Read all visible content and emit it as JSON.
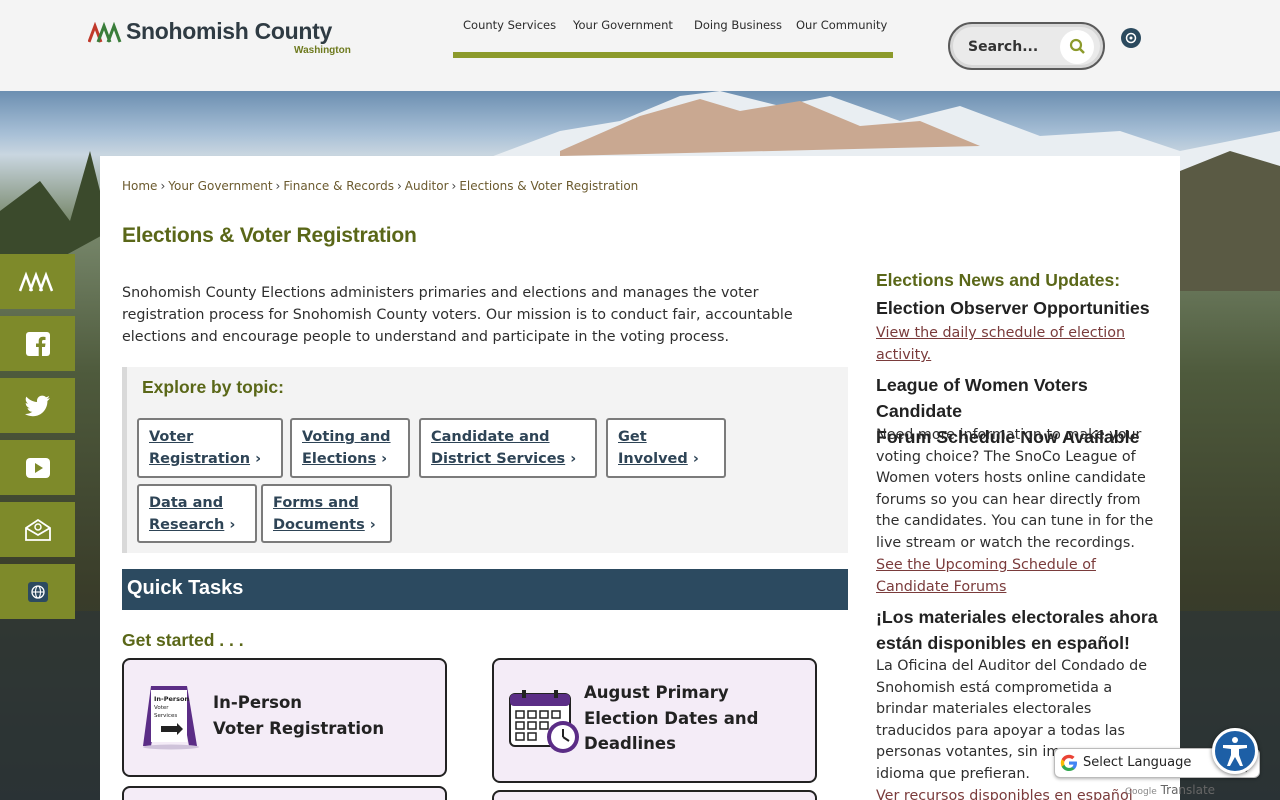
{
  "header": {
    "logo": {
      "name": "Snohomish County",
      "sub": "Washington"
    },
    "nav": [
      "County Services",
      "Your Government",
      "Doing Business",
      "Our Community"
    ],
    "search_placeholder": "Search..."
  },
  "breadcrumbs": [
    "Home",
    "Your Government",
    "Finance & Records",
    "Auditor",
    "Elections & Voter Registration"
  ],
  "page_title": "Elections & Voter Registration",
  "intro": "Snohomish County Elections administers primaries and elections and manages the voter registration process for Snohomish County voters. Our mission is to conduct fair, accountable elections and encourage people to understand and participate in the voting process.",
  "explore": {
    "title": "Explore by topic:",
    "topics": [
      {
        "line1": "Voter",
        "line2": "Registration"
      },
      {
        "line1": "Voting and",
        "line2": "Elections"
      },
      {
        "line1": "Candidate and",
        "line2": "District Services"
      },
      {
        "line1": "Get",
        "line2": "Involved"
      },
      {
        "line1": "Data and",
        "line2": "Research"
      },
      {
        "line1": "Forms and",
        "line2": "Documents"
      }
    ]
  },
  "quick_tasks": {
    "title": "Quick Tasks",
    "subtitle": "Get started . . .",
    "tasks": [
      {
        "line1": "In-Person",
        "line2": "Voter Registration",
        "line3": ""
      },
      {
        "line1": "August Primary",
        "line2": "Election Dates and",
        "line3": "Deadlines"
      }
    ],
    "sign_text": "In-Person Voter Services"
  },
  "sidebar": {
    "heading": "Elections News and Updates:",
    "items": [
      {
        "title_lines": [
          "Election Observer Opportunities"
        ],
        "body_lines": [],
        "link_lines": [
          "View the daily schedule of election",
          "activity."
        ]
      },
      {
        "title_lines": [
          "League of Women Voters Candidate",
          "Forum Schedule Now Available"
        ],
        "body_lines": [
          "Need more information to make your",
          "voting choice? The SnoCo League of",
          "Women voters hosts online candidate",
          "forums so you can hear directly from",
          "the candidates. You can tune in for the",
          "live stream or watch the recordings."
        ],
        "link_lines": [
          "See the Upcoming Schedule of",
          "Candidate Forums"
        ]
      },
      {
        "title_lines": [
          "¡Los materiales electorales ahora",
          "están disponibles en español!"
        ],
        "body_lines": [
          "La Oficina del Auditor del Condado de",
          "Snohomish está comprometida a",
          "brindar materiales electorales",
          "traducidos para apoyar a todas las",
          "personas votantes, sin im",
          "idioma que prefieran."
        ],
        "link_lines": [
          "Ver recursos disponibles en español"
        ]
      }
    ]
  },
  "translate": {
    "label": "Select Language",
    "powered": "Translate",
    "powered_prefix": "Google"
  },
  "colors": {
    "olive": "#7e8a2a",
    "navy": "#2c4a60",
    "title": "#5a6718",
    "task_bg": "#f4ecf7"
  }
}
